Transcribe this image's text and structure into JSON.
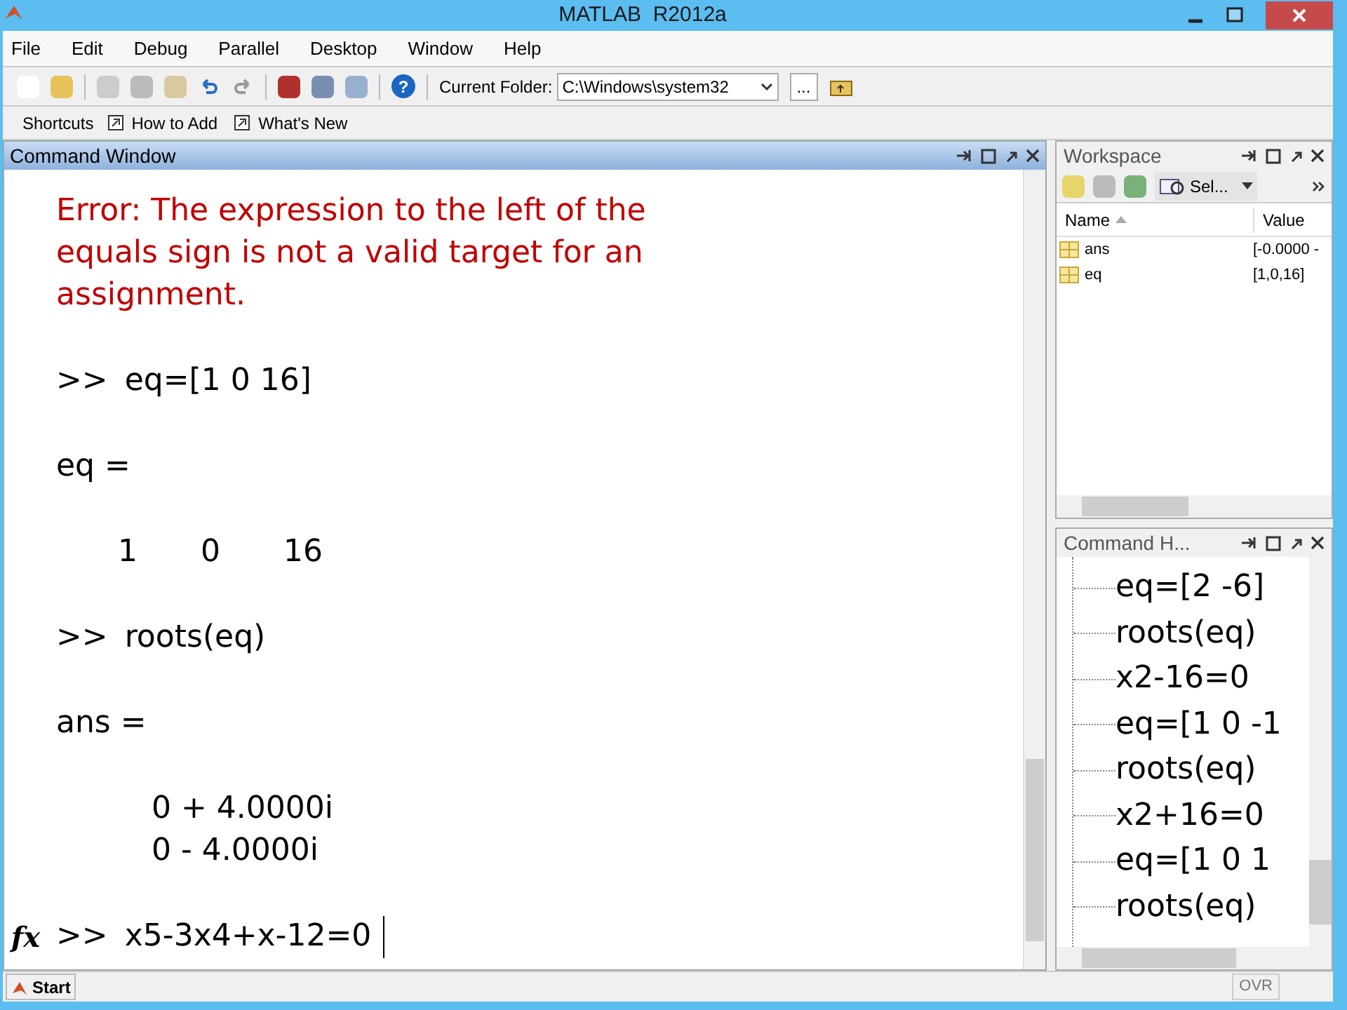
{
  "window": {
    "title": "MATLAB  R2012a"
  },
  "menu": [
    "File",
    "Edit",
    "Debug",
    "Parallel",
    "Desktop",
    "Window",
    "Help"
  ],
  "toolbar": {
    "current_folder_label": "Current Folder:",
    "current_folder": "C:\\Windows\\system32",
    "browse": "...",
    "help": "?"
  },
  "shortcuts": {
    "label": "Shortcuts",
    "items": [
      "How to Add",
      "What's New"
    ]
  },
  "command_window": {
    "title": "Command Window",
    "blocks": [
      {
        "kind": "error",
        "lines": [
          "Error: The expression to the left of the",
          "equals sign is not a valid target for an",
          "assignment."
        ]
      },
      {
        "kind": "prompt",
        "prompt": ">>",
        "text": "eq=[1 0 16]"
      },
      {
        "kind": "output",
        "lines": [
          "eq ="
        ]
      },
      {
        "kind": "matrix",
        "cells": [
          "1",
          "0",
          "16"
        ]
      },
      {
        "kind": "prompt",
        "prompt": ">>",
        "text": "roots(eq)"
      },
      {
        "kind": "output",
        "lines": [
          "ans ="
        ]
      },
      {
        "kind": "values",
        "lines": [
          "0 + 4.0000i",
          "0 - 4.0000i"
        ]
      },
      {
        "kind": "current",
        "icon": "fx",
        "prompt": ">>",
        "text": "x5-3x4+x-12=0"
      }
    ]
  },
  "workspace": {
    "title": "Workspace",
    "select": "Sel...",
    "columns": [
      "Name",
      "Value"
    ],
    "rows": [
      {
        "name": "ans",
        "value": "[-0.0000 -"
      },
      {
        "name": "eq",
        "value": "[1,0,16]"
      }
    ]
  },
  "command_history": {
    "title": "Command H...",
    "items": [
      "eq=[2 -6]",
      "roots(eq)",
      "x2-16=0",
      "eq=[1 0 -1",
      "roots(eq)",
      "x2+16=0",
      "eq=[1 0 1",
      "roots(eq)"
    ]
  },
  "status_bar": {
    "start": "Start",
    "mode": "OVR"
  }
}
